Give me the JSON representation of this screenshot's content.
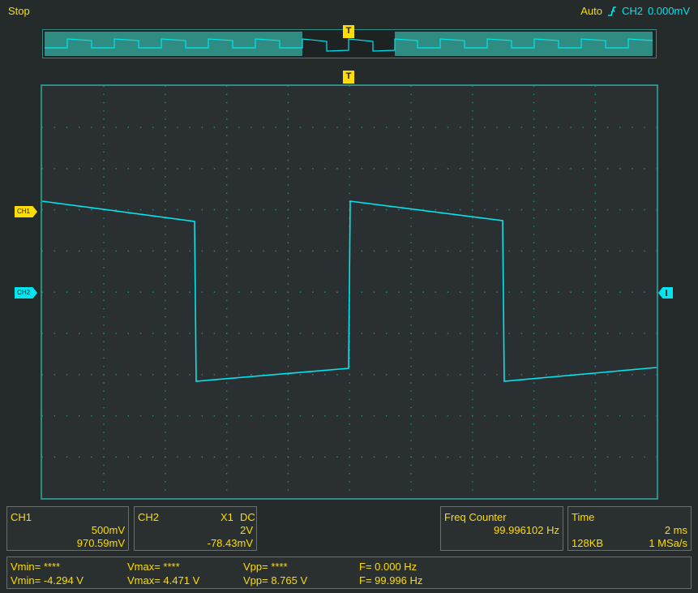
{
  "status": {
    "run_state": "Stop",
    "trigger_mode": "Auto",
    "trigger_source": "CH2",
    "trigger_level": "0.000mV"
  },
  "markers": {
    "trigger": "T",
    "ch1": "CH1",
    "ch2": "CH2"
  },
  "ch1": {
    "label": "CH1",
    "scale": "500mV",
    "offset": "970.59mV"
  },
  "ch2": {
    "label": "CH2",
    "probe": "X1",
    "coupling": "DC",
    "scale": "2V",
    "offset": "-78.43mV"
  },
  "freq_counter": {
    "label": "Freq Counter",
    "value": "99.996102 Hz"
  },
  "timebase": {
    "label": "Time",
    "scale": "2 ms",
    "memory": "128KB",
    "sample_rate": "1 MSa/s"
  },
  "measurements": {
    "row1": {
      "vmin": "Vmin= ****",
      "vmax": "Vmax= ****",
      "vpp": "Vpp= ****",
      "freq": "F= 0.000 Hz"
    },
    "row2": {
      "vmin": "Vmin= -4.294 V",
      "vmax": "Vmax= 4.471 V",
      "vpp": "Vpp= 8.765 V",
      "freq": "F= 99.996 Hz"
    }
  },
  "colors": {
    "ch1": "#ffdd00",
    "ch2": "#00e5ee",
    "grid": "#2e8c85"
  }
}
